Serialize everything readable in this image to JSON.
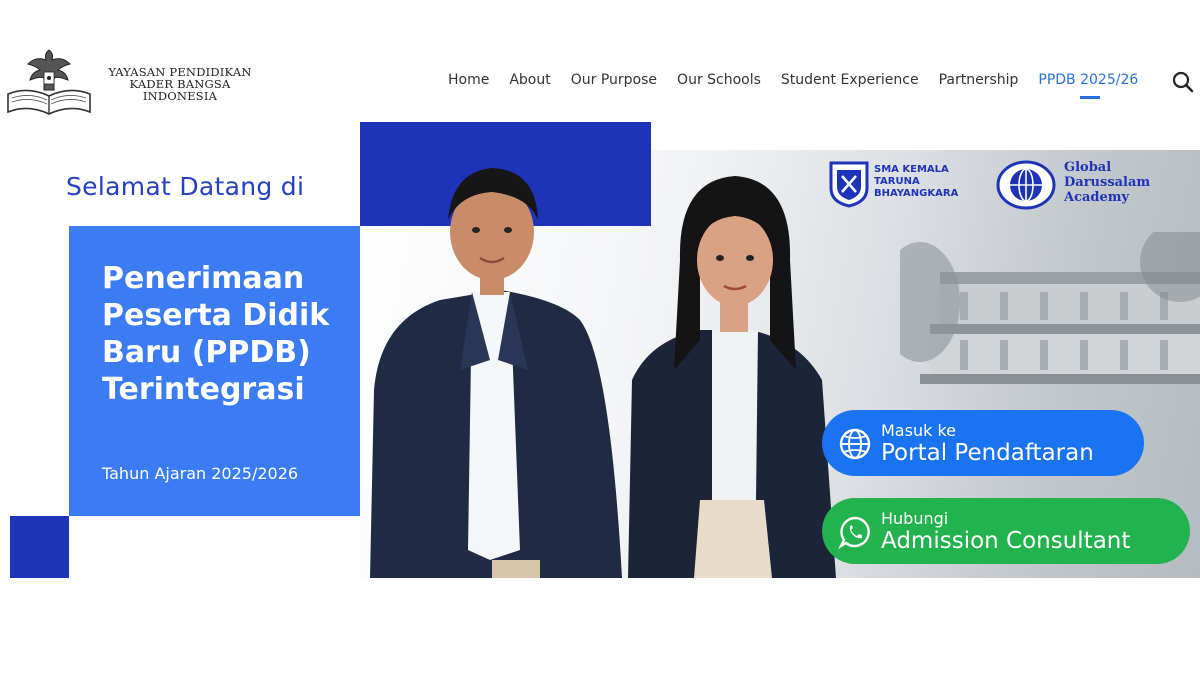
{
  "header": {
    "org_name": [
      "YAYASAN PENDIDIKAN",
      "KADER BANGSA",
      "INDONESIA"
    ],
    "nav": [
      {
        "label": "Home"
      },
      {
        "label": "About"
      },
      {
        "label": "Our Purpose"
      },
      {
        "label": "Our Schools"
      },
      {
        "label": "Student Experience"
      },
      {
        "label": "Partnership"
      },
      {
        "label": "PPDB 2025/26",
        "active": true
      }
    ],
    "search_icon": "search-icon"
  },
  "hero": {
    "welcome": "Selamat Datang di",
    "title_lines": [
      "Penerimaan",
      "Peserta Didik",
      "Baru (PPDB)",
      "Terintegrasi"
    ],
    "year": "Tahun Ajaran 2025/2026"
  },
  "schools": [
    {
      "name_lines": [
        "SMA KEMALA",
        "TARUNA",
        "BHAYANGKARA"
      ],
      "icon": "shield-crest-icon"
    },
    {
      "name_lines": [
        "Global",
        "Darussalam",
        "Academy"
      ],
      "icon": "globe-crest-icon"
    }
  ],
  "cta": {
    "portal": {
      "line1": "Masuk ke",
      "line2": "Portal Pendaftaran",
      "icon": "globe-icon"
    },
    "whatsapp": {
      "line1": "Hubungi",
      "line2": "Admission Consultant",
      "icon": "whatsapp-icon"
    }
  },
  "colors": {
    "primary_blue": "#1d33b8",
    "bright_blue": "#3b7cf5",
    "portal_button": "#1a73f0",
    "whatsapp_button": "#23b34e",
    "nav_active": "#2a6fdb"
  }
}
